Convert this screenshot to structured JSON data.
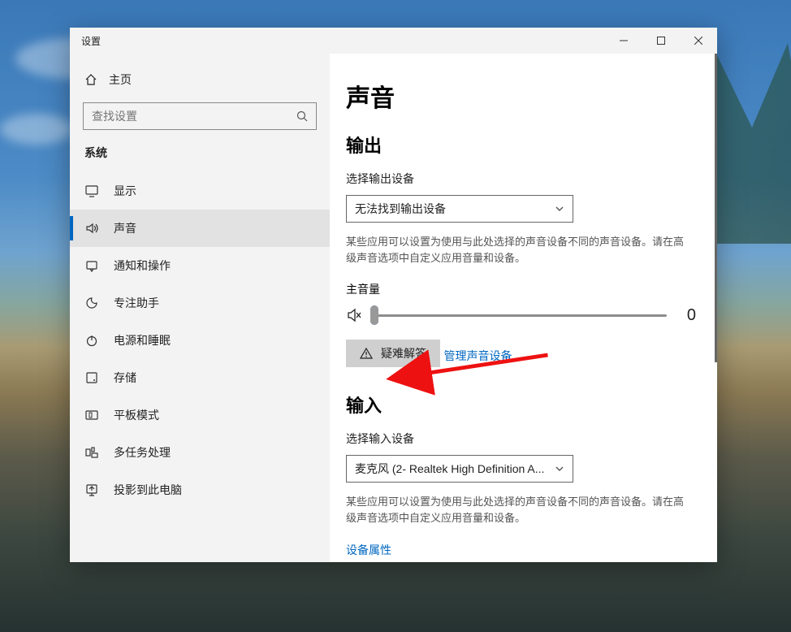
{
  "window": {
    "title": "设置"
  },
  "sidebar": {
    "home_label": "主页",
    "search_placeholder": "查找设置",
    "category": "系统",
    "items": [
      {
        "icon": "display",
        "label": "显示"
      },
      {
        "icon": "sound",
        "label": "声音",
        "active": true
      },
      {
        "icon": "notify",
        "label": "通知和操作"
      },
      {
        "icon": "focus",
        "label": "专注助手"
      },
      {
        "icon": "power",
        "label": "电源和睡眠"
      },
      {
        "icon": "storage",
        "label": "存储"
      },
      {
        "icon": "tablet",
        "label": "平板模式"
      },
      {
        "icon": "multi",
        "label": "多任务处理"
      },
      {
        "icon": "project",
        "label": "投影到此电脑"
      }
    ]
  },
  "main": {
    "title": "声音",
    "output_heading": "输出",
    "output_select_label": "选择输出设备",
    "output_select_value": "无法找到输出设备",
    "output_desc": "某些应用可以设置为使用与此处选择的声音设备不同的声音设备。请在高级声音选项中自定义应用音量和设备。",
    "master_volume_label": "主音量",
    "master_volume_value": "0",
    "troubleshoot_label": "疑难解答",
    "manage_link": "管理声音设备",
    "input_heading": "输入",
    "input_select_label": "选择输入设备",
    "input_select_value": "麦克风 (2- Realtek High Definition A...",
    "input_desc": "某些应用可以设置为使用与此处选择的声音设备不同的声音设备。请在高级声音选项中自定义应用音量和设备。",
    "device_props_link": "设备属性"
  }
}
